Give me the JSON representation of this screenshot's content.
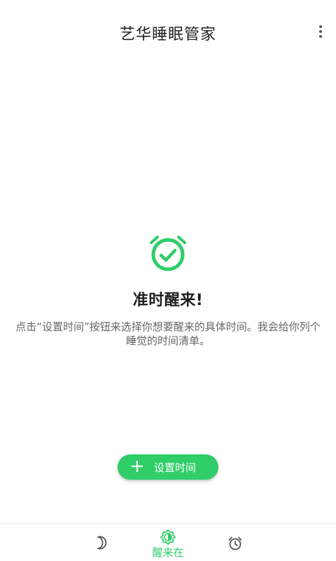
{
  "app_bar": {
    "title": "艺华睡眠管家",
    "more_icon": "more-vert-icon"
  },
  "empty_state": {
    "icon": "alarm-check-icon",
    "title": "准时醒来!",
    "description": "点击“设置时间”按钮来选择你想要醒来的具体时间。我会给你列个睡觉的时间清单。"
  },
  "action": {
    "set_time_label": "设置时间",
    "icon": "plus-icon"
  },
  "bottom_nav": {
    "items": [
      {
        "icon": "moon-icon",
        "label": "",
        "active": false
      },
      {
        "icon": "sun-alarm-icon",
        "label": "醒来在",
        "active": true
      },
      {
        "icon": "alarm-clock-icon",
        "label": "",
        "active": false
      }
    ]
  },
  "colors": {
    "accent": "#2fce68",
    "title_text": "#222222",
    "body_text": "#666666",
    "inactive_icon": "#666666"
  }
}
